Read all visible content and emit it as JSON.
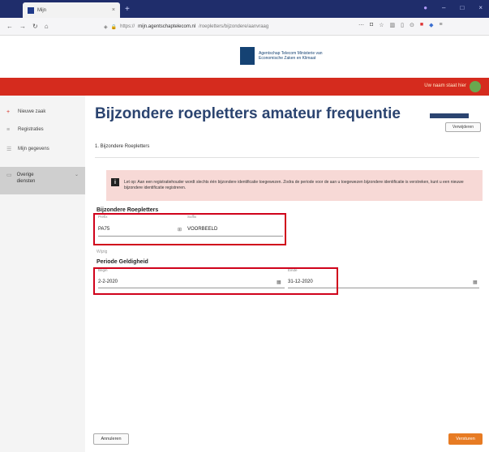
{
  "browser": {
    "tab_title": "Mijn",
    "url_prefix": "https://",
    "url_host": "mijn.agentschaptelecom.nl",
    "url_rest": "/roepletters/bijzondere/aanvraag",
    "nav_icons": [
      "back-icon",
      "forward-icon",
      "reload-icon",
      "home-icon"
    ]
  },
  "site": {
    "logo_text": "Agentschap Telecom Ministerie van Economische Zaken en Klimaat",
    "user_label": "Uw naam staat hier"
  },
  "sidebar": {
    "items": [
      {
        "label": "Nieuwe zaak",
        "icon": "plus-icon"
      },
      {
        "label": "Registraties",
        "icon": "list-icon"
      },
      {
        "label": "Mijn gegevens",
        "icon": "user-icon"
      }
    ],
    "active": {
      "label": "Overige diensten",
      "icon": "folder-icon"
    }
  },
  "page": {
    "title": "Bijzondere roepletters amateur frequentie",
    "top_button": "Verwijderen",
    "section": "1. Bijzondere Roepletters",
    "alert_text": "Let op: Aan een registratiehouder wordt slechts één bijzondere identificatie toegewezen. Zodra de periode voor de aan u toegewezen bijzondere identificatie is verstreken, kunt u een nieuwe bijzondere identificatie registreren."
  },
  "form": {
    "group1_title": "Bijzondere Roepletters",
    "prefix_label": "Prefix",
    "prefix_value": "PA75",
    "suffix_label": "Suffix",
    "suffix_value": "VOORBEELD",
    "period_link": "Wijzig",
    "group2_title": "Periode Geldigheid",
    "start_label": "Begin",
    "start_value": "2-2-2020",
    "end_label": "Einde",
    "end_value": "31-12-2020"
  },
  "footer": {
    "cancel": "Annuleren",
    "submit": "Versturen"
  }
}
